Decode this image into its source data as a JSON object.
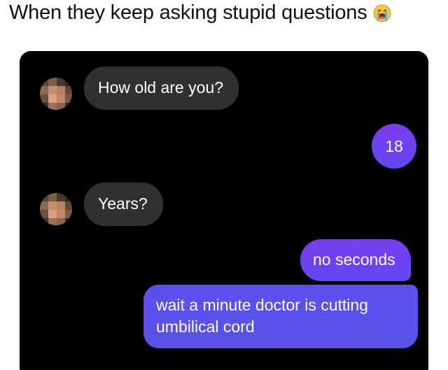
{
  "caption": {
    "text": "When they keep asking stupid questions",
    "emoji": "loudly-crying-face"
  },
  "chat": {
    "colors": {
      "background": "#000000",
      "incoming_bubble": "#303030",
      "outgoing_bubble_top": "#7a3df0",
      "outgoing_bubble_bottom": "#5a52ea",
      "text": "#ffffff"
    },
    "messages": [
      {
        "direction": "incoming",
        "text": "How old are you?"
      },
      {
        "direction": "outgoing",
        "text": "18"
      },
      {
        "direction": "incoming",
        "text": "Years?"
      },
      {
        "direction": "outgoing",
        "text": "no seconds"
      },
      {
        "direction": "outgoing",
        "text": "wait a minute doctor is cutting umbilical cord"
      }
    ]
  }
}
